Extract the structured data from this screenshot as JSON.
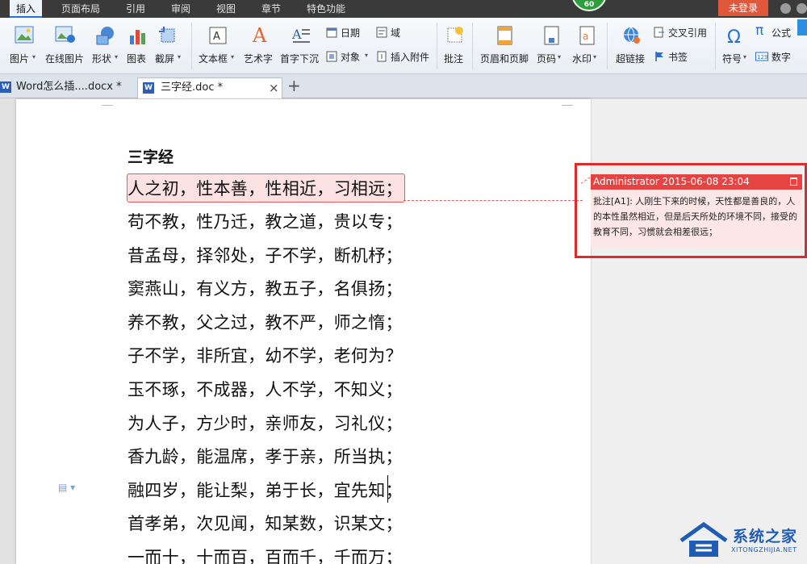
{
  "menubar": {
    "tabs": [
      "插入",
      "页面布局",
      "引用",
      "审阅",
      "视图",
      "章节",
      "特色功能"
    ],
    "active_tab": "插入",
    "score": "60",
    "login": "未登录"
  },
  "ribbon": {
    "picture": "图片",
    "online_picture": "在线图片",
    "shape": "形状",
    "chart": "图表",
    "screenshot": "截屏",
    "textbox": "文本框",
    "wordart": "艺术字",
    "dropcap": "首字下沉",
    "date": "日期",
    "object": "对象",
    "field": "域",
    "attachment": "插入附件",
    "comment": "批注",
    "header_footer": "页眉和页脚",
    "page_number": "页码",
    "watermark": "水印",
    "hyperlink": "超链接",
    "cross_ref": "交叉引用",
    "bookmark": "书签",
    "symbol": "符号",
    "formula": "公式",
    "number": "数字"
  },
  "tabs": {
    "doc1": "Word怎么插....docx *",
    "doc2": "三字经.doc *",
    "add": "+"
  },
  "document": {
    "title": "三字经",
    "lines": [
      "人之初，性本善，性相近，习相远；",
      "苟不教，性乃迁，教之道，贵以专；",
      "昔孟母，择邻处，子不学，断机杼；",
      "窦燕山，有义方，教五子，名俱扬；",
      "养不教，父之过，教不严，师之惰；",
      "子不学，非所宜，幼不学，老何为？",
      "玉不琢，不成器，人不学，不知义；",
      "为人子，方少时，亲师友，习礼仪；",
      "香九龄，能温席，孝于亲，所当执；",
      "融四岁，能让梨，弟于长，宜先知；",
      "首孝弟，次见闻，知某数，识某文；",
      "一而十，十而百，百而千，千而万；"
    ]
  },
  "comment": {
    "header": "Administrator 2015-06-08 23:04",
    "body": "批注[A1]: 人刚生下来的时候，天性都是善良的，人的本性虽然相近，但是后天所处的环境不同，接受的教育不同，习惯就会相差很远；"
  },
  "watermark": {
    "name": "系统之家",
    "url": "XITONGZHIJIA.NET"
  },
  "colors": {
    "menubar": "#3a3a3a",
    "login": "#e0573a",
    "score": "#2d9d3d",
    "comment_header": "#e64343",
    "comment_bg": "#fde6e6",
    "highlight_border": "#e65b5b",
    "brand_blue": "#1e5cb5"
  }
}
